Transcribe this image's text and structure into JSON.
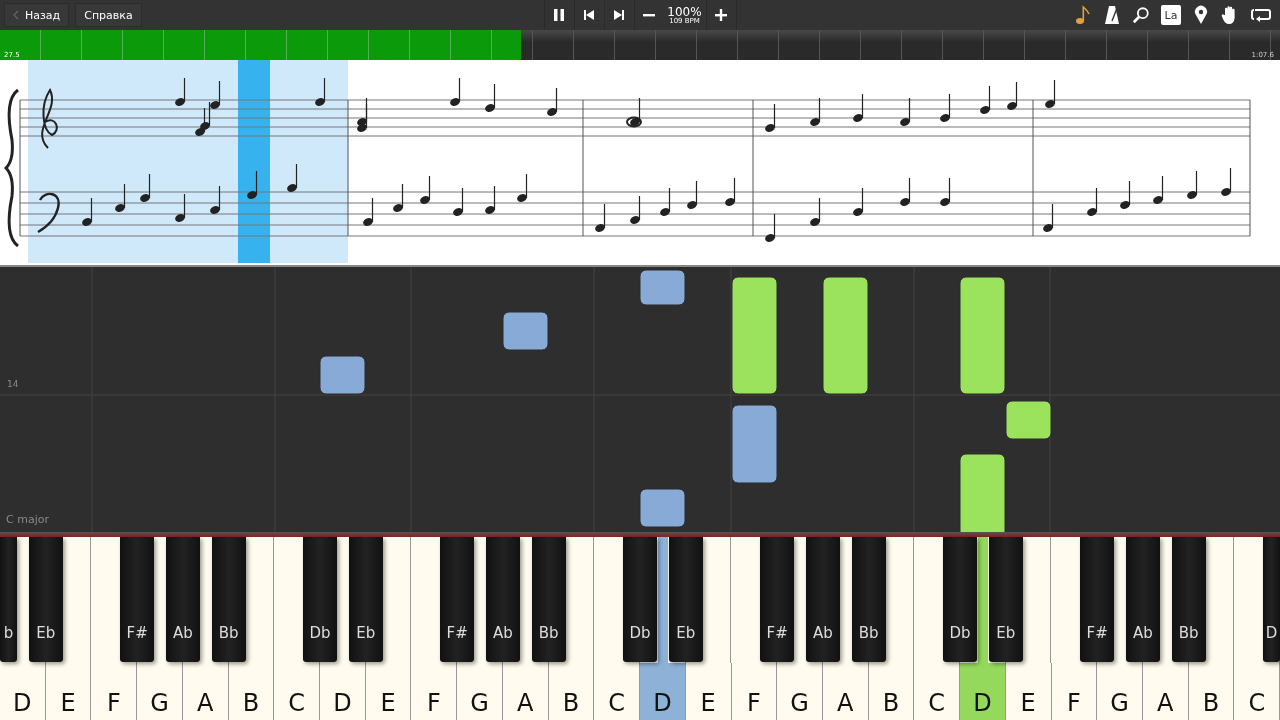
{
  "toolbar": {
    "back_button": "Назад",
    "help_button": "Справка",
    "playing": true,
    "speed": "100%",
    "tempo": "109 BPM",
    "label_button": "La"
  },
  "progress": {
    "level": 0.407,
    "start_time": "27.5",
    "end_time": "1:07.6"
  },
  "note_field": {
    "measure_number": "14",
    "key_signature": "C major"
  },
  "keyboard": {
    "white_keys": [
      {
        "label": "D",
        "pressed": false
      },
      {
        "label": "E",
        "pressed": false
      },
      {
        "label": "F",
        "pressed": false
      },
      {
        "label": "G",
        "pressed": false
      },
      {
        "label": "A",
        "pressed": false
      },
      {
        "label": "B",
        "pressed": false
      },
      {
        "label": "C",
        "pressed": false
      },
      {
        "label": "D",
        "pressed": false
      },
      {
        "label": "E",
        "pressed": false
      },
      {
        "label": "F",
        "pressed": false
      },
      {
        "label": "G",
        "pressed": false
      },
      {
        "label": "A",
        "pressed": false
      },
      {
        "label": "B",
        "pressed": false
      },
      {
        "label": "C",
        "pressed": false
      },
      {
        "label": "D",
        "pressed": true,
        "color": "#8eb1d8"
      },
      {
        "label": "E",
        "pressed": false
      },
      {
        "label": "F",
        "pressed": false
      },
      {
        "label": "G",
        "pressed": false
      },
      {
        "label": "A",
        "pressed": false
      },
      {
        "label": "B",
        "pressed": false
      },
      {
        "label": "C",
        "pressed": false
      },
      {
        "label": "D",
        "pressed": true,
        "color": "#95d95c"
      },
      {
        "label": "E",
        "pressed": false
      },
      {
        "label": "F",
        "pressed": false
      },
      {
        "label": "G",
        "pressed": false
      },
      {
        "label": "A",
        "pressed": false
      },
      {
        "label": "B",
        "pressed": false
      },
      {
        "label": "C",
        "pressed": false
      }
    ],
    "black_keys": [
      {
        "label": "b"
      },
      {
        "label": "Eb"
      },
      {
        "label": "F#"
      },
      {
        "label": "Ab"
      },
      {
        "label": "Bb"
      },
      {
        "label": "Db"
      },
      {
        "label": "Eb"
      },
      {
        "label": "F#"
      },
      {
        "label": "Ab"
      },
      {
        "label": "Bb"
      },
      {
        "label": "Db"
      },
      {
        "label": "Eb"
      },
      {
        "label": "F#"
      },
      {
        "label": "Ab"
      },
      {
        "label": "Bb"
      },
      {
        "label": "Db"
      },
      {
        "label": "Eb"
      },
      {
        "label": "F#"
      },
      {
        "label": "Ab"
      },
      {
        "label": "Bb"
      },
      {
        "label": "D"
      }
    ]
  }
}
